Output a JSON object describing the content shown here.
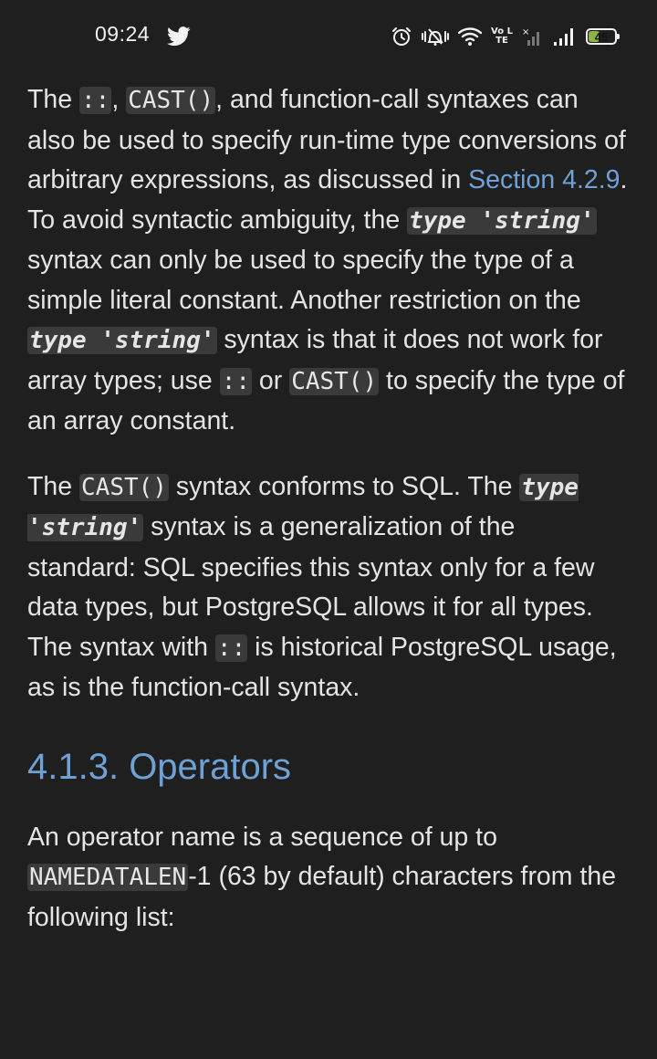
{
  "status_bar": {
    "time": "09:24",
    "network": "Vo LTE",
    "battery_level": "45",
    "battery_percent": 45
  },
  "para1": {
    "t1": "The ",
    "c1": "::",
    "t2": ", ",
    "c2": "CAST()",
    "t3": ", and function-call syntaxes can also be used to specify run-time type conversions of arbitrary expressions, as discussed in ",
    "link": "Section 4.2.9",
    "t4": ". To avoid syntactic ambiguity, the ",
    "c3a": "type",
    "c3b": " 'string'",
    "t5": " syntax can only be used to specify the type of a simple literal constant. Another restriction on the ",
    "c4a": "type",
    "c4b": " 'string'",
    "t6": " syntax is that it does not work for array types; use ",
    "c5": "::",
    "t7": " or ",
    "c6": "CAST()",
    "t8": " to specify the type of an array constant."
  },
  "para2": {
    "t1": "The ",
    "c1": "CAST()",
    "t2": " syntax conforms to SQL. The ",
    "c2a": "type",
    "c2b": " 'string'",
    "t3": " syntax is a generalization of the standard: SQL specifies this syntax only for a few data types, but PostgreSQL allows it for all types. The syntax with ",
    "c3": "::",
    "t4": " is historical PostgreSQL usage, as is the function-call syntax."
  },
  "heading": "4.1.3. Operators",
  "para3": {
    "t1": "An operator name is a sequence of up to ",
    "c1": "NAMEDATALEN",
    "t2": "-1 (63 by default) characters from the following list:"
  },
  "icons": [
    "twitter-icon",
    "alarm-icon",
    "vibrate-icon",
    "wifi-icon",
    "volte-icon",
    "no-signal-icon",
    "signal-icon",
    "battery-icon"
  ]
}
